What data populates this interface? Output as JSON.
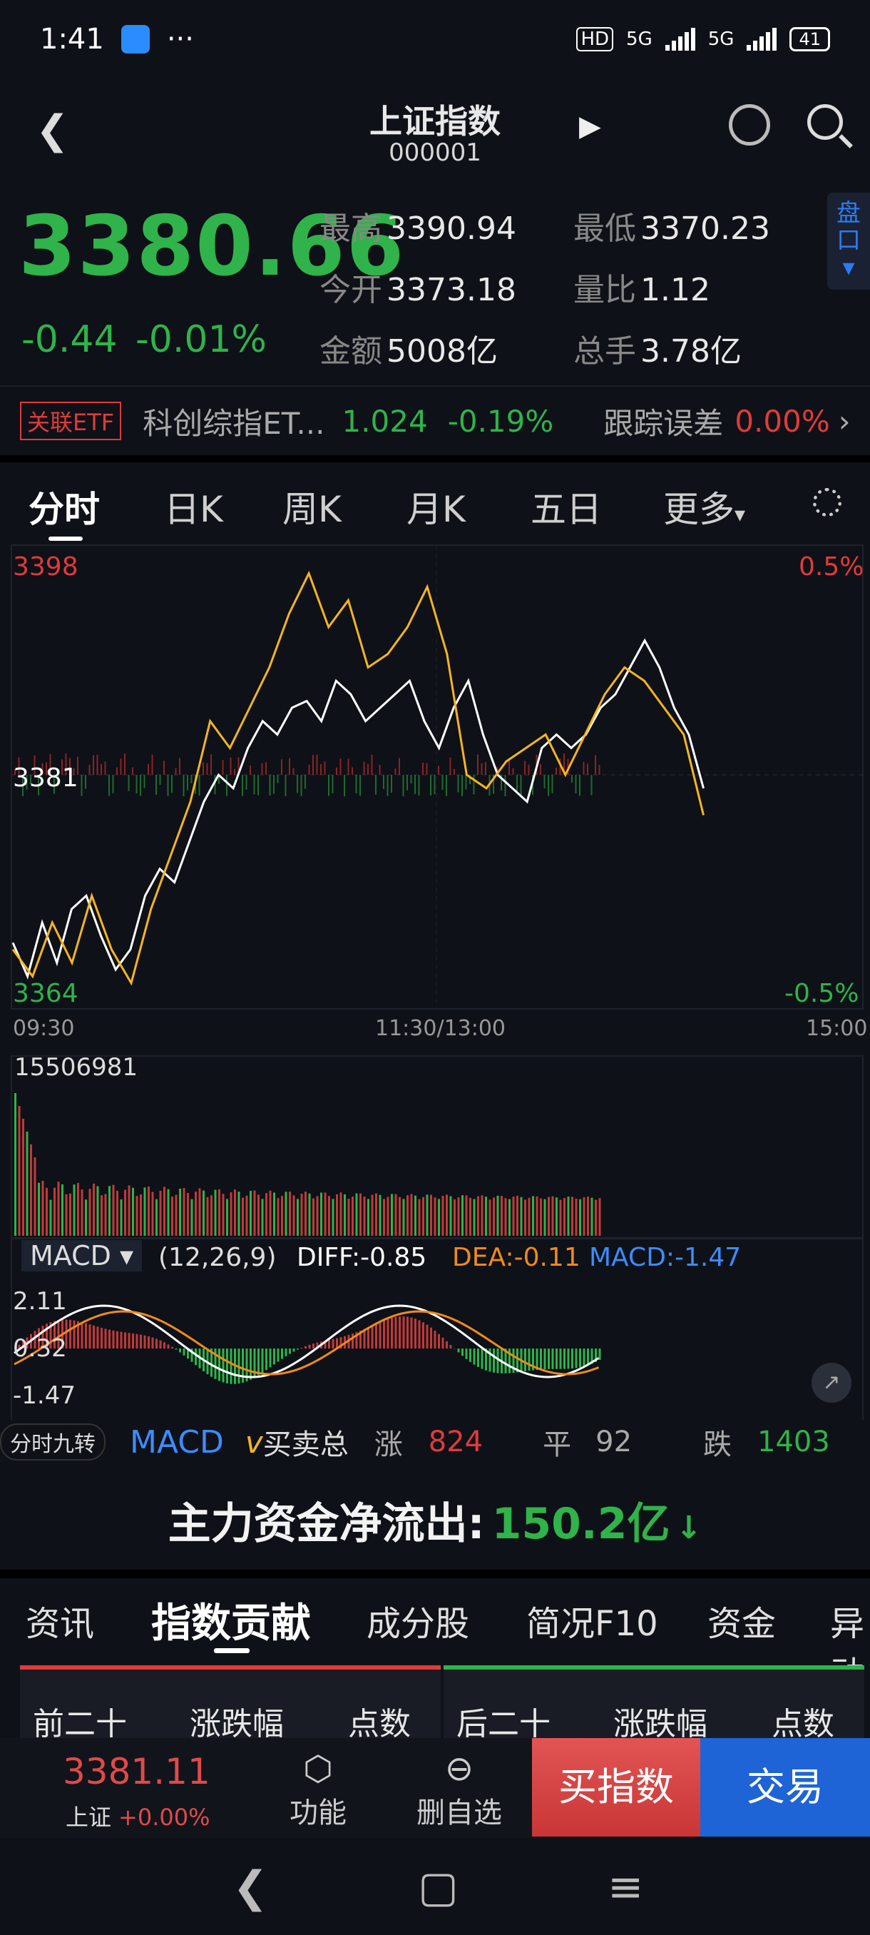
{
  "status": {
    "time": "1:41",
    "dots": "···",
    "hd": "HD",
    "net1": "5G",
    "net2": "5G",
    "battery": "41"
  },
  "header": {
    "title": "上证指数",
    "code": "000001"
  },
  "quote": {
    "price": "3380.66",
    "change": "-0.44",
    "change_pct": "-0.01%",
    "high_label": "最高",
    "high": "3390.94",
    "low_label": "最低",
    "low": "3370.23",
    "open_label": "今开",
    "open": "3373.18",
    "ratio_label": "量比",
    "ratio": "1.12",
    "amount_label": "金额",
    "amount": "5008亿",
    "turnover_label": "总手",
    "turnover": "3.78亿",
    "pankou": "盘口"
  },
  "etf": {
    "tag": "关联ETF",
    "name": "科创综指ET...",
    "price": "1.024",
    "change_pct": "-0.19%",
    "track_label": "跟踪误差",
    "track_value": "0.00%"
  },
  "tabs": [
    "分时",
    "日K",
    "周K",
    "月K",
    "五日",
    "更多"
  ],
  "chart_labels": {
    "y_top": "3398",
    "y_mid": "3381",
    "y_bottom": "3364",
    "pct_top": "0.5%",
    "pct_bottom": "-0.5%",
    "x_start": "09:30",
    "x_mid": "11:30/13:00",
    "x_end": "15:00",
    "volume_max": "15506981",
    "macd_name": "MACD",
    "macd_params": "(12,26,9)",
    "diff": "DIFF:-0.85",
    "dea": "DEA:-0.11",
    "macd_val": "MACD:-1.47",
    "macd_top": "2.11",
    "macd_mid": "0.32",
    "macd_bottom": "-1.47"
  },
  "breadth": {
    "pill": "分时九转",
    "macd": "MACD",
    "vbs": "买卖总",
    "up_label": "涨",
    "up": "824",
    "flat_label": "平",
    "flat": "92",
    "down_label": "跌",
    "down": "1403"
  },
  "flow": {
    "label": "主力资金净流出:",
    "value": "150.2亿"
  },
  "subtabs": [
    "资讯",
    "指数贡献",
    "成分股",
    "简况F10",
    "资金",
    "异动"
  ],
  "boards": {
    "left_a": "前二十",
    "left_b": "涨跌幅",
    "left_c": "点数",
    "right_a": "后二十",
    "right_b": "涨跌幅",
    "right_c": "点数"
  },
  "bottom": {
    "price": "3381.11",
    "name": "上证",
    "pct": "+0.00%",
    "func": "功能",
    "remove": "删自选",
    "buy": "买指数",
    "trade": "交易"
  },
  "chart_data": {
    "type": "line",
    "title": "",
    "xlabel": "",
    "ylabel": "",
    "ylim": [
      3364,
      3398
    ],
    "x_range": [
      "09:30",
      "15:00"
    ],
    "series": [
      {
        "values": [
          3368.5,
          3366,
          3370,
          3367,
          3371,
          3372,
          3369,
          3366.5,
          3368,
          3372,
          3374,
          3373,
          3376,
          3379,
          3381,
          3380,
          3383,
          3385,
          3384,
          3386,
          3386.5,
          3385,
          3388,
          3387,
          3385,
          3386,
          3387,
          3388,
          3385,
          3383,
          3386,
          3388,
          3384,
          3381,
          3380,
          3379,
          3383,
          3384,
          3383,
          3384,
          3386,
          3387,
          3389,
          3391,
          3389,
          3386,
          3384,
          3380
        ]
      },
      {
        "values": [
          3368,
          3366,
          3370,
          3367,
          3372,
          3368,
          3365.5,
          3371,
          3375,
          3379,
          3385,
          3383,
          3386,
          3389,
          3393,
          3396,
          3392,
          3394,
          3389,
          3390,
          3392,
          3395,
          3390,
          3381,
          3380,
          3382,
          3383,
          3384,
          3381,
          3384,
          3387,
          3389,
          3388,
          3386,
          3384,
          3378
        ]
      }
    ]
  },
  "colors": {
    "up": "#e03b3b",
    "down": "#2fb34a",
    "index": "#ffffff",
    "avg": "#f5b521",
    "accent": "#1e64d6"
  }
}
